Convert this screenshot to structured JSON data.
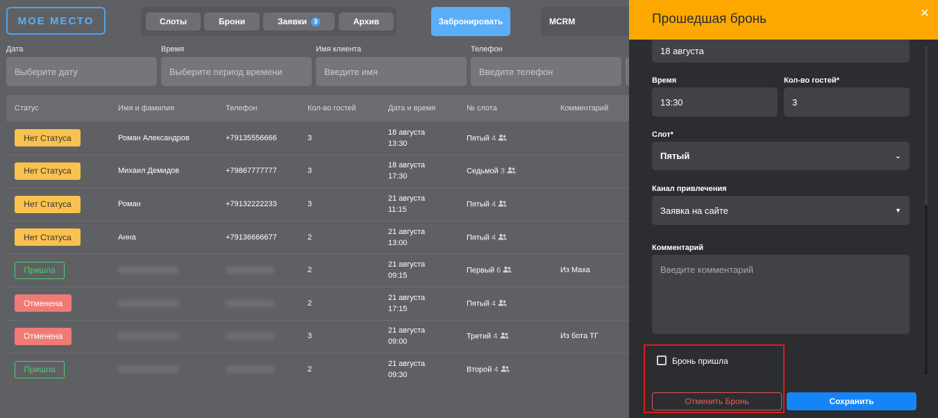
{
  "app": {
    "logo": "МОЕ МЕСТО"
  },
  "nav": {
    "tabs": [
      {
        "label": "Слоты"
      },
      {
        "label": "Брони"
      },
      {
        "label": "Заявки",
        "badge": "3"
      },
      {
        "label": "Архив"
      }
    ],
    "book_button": "Забронировать",
    "crm_label": "MCRM"
  },
  "filters": {
    "date": {
      "label": "Дата",
      "placeholder": "Выберите дату"
    },
    "time": {
      "label": "Время",
      "placeholder": "Выберите период времени"
    },
    "client": {
      "label": "Имя клиента",
      "placeholder": "Введите имя"
    },
    "phone": {
      "label": "Телефон",
      "placeholder": "Введите телефон"
    }
  },
  "table": {
    "columns": [
      "Статус",
      "Имя и фамилия",
      "Телефон",
      "Кол-во гостей",
      "Дата и время",
      "№ слота",
      "Комментарий"
    ],
    "rows": [
      {
        "status": "Нет Статуса",
        "status_type": "none",
        "name": "Роман Александров",
        "phone": "+79135556666",
        "guests": "3",
        "date": "18 августа",
        "time": "13:30",
        "slot": "Пятый",
        "capacity": "4",
        "comment": ""
      },
      {
        "status": "Нет Статуса",
        "status_type": "none",
        "name": "Михаил Демидов",
        "phone": "+79867777777",
        "guests": "3",
        "date": "18 августа",
        "time": "17:30",
        "slot": "Седьмой",
        "capacity": "3",
        "comment": ""
      },
      {
        "status": "Нет Статуса",
        "status_type": "none",
        "name": "Роман",
        "phone": "+79132222233",
        "guests": "3",
        "date": "21 августа",
        "time": "11:15",
        "slot": "Пятый",
        "capacity": "4",
        "comment": ""
      },
      {
        "status": "Нет Статуса",
        "status_type": "none",
        "name": "Анна",
        "phone": "+79136666677",
        "guests": "2",
        "date": "21 августа",
        "time": "13:00",
        "slot": "Пятый",
        "capacity": "4",
        "comment": ""
      },
      {
        "status": "Пришла",
        "status_type": "came",
        "name": "",
        "phone": "",
        "guests": "2",
        "date": "21 августа",
        "time": "09:15",
        "slot": "Первый",
        "capacity": "6",
        "comment": "Из Маха"
      },
      {
        "status": "Отменена",
        "status_type": "cancel",
        "name": "",
        "phone": "",
        "guests": "2",
        "date": "21 августа",
        "time": "17:15",
        "slot": "Пятый",
        "capacity": "4",
        "comment": ""
      },
      {
        "status": "Отменена",
        "status_type": "cancel",
        "name": "",
        "phone": "",
        "guests": "3",
        "date": "21 августа",
        "time": "09:00",
        "slot": "Третий",
        "capacity": "4",
        "comment": "Из бота ТГ"
      },
      {
        "status": "Пришла",
        "status_type": "came",
        "name": "",
        "phone": "",
        "guests": "2",
        "date": "21 августа",
        "time": "09:30",
        "slot": "Второй",
        "capacity": "4",
        "comment": ""
      }
    ]
  },
  "panel": {
    "title": "Прошедшая бронь",
    "date_value": "18 августа",
    "time_label": "Время",
    "time_value": "13:30",
    "guests_label": "Кол-во гостей*",
    "guests_value": "3",
    "slot_label": "Слот*",
    "slot_value": "Пятый",
    "channel_label": "Канал привлечения",
    "channel_value": "Заявка на сайте",
    "comment_label": "Комментарий",
    "comment_placeholder": "Введите комментарий",
    "checkbox_label": "Бронь пришла",
    "cancel_button": "Отменить Бронь",
    "save_button": "Сохранить"
  },
  "colors": {
    "panel_header": "#fca800",
    "primary_button": "#1585f5",
    "status_none": "#f9c14e",
    "status_came": "#4ecf6a",
    "status_cancel": "#f07a74",
    "highlight": "#e01b1b"
  }
}
